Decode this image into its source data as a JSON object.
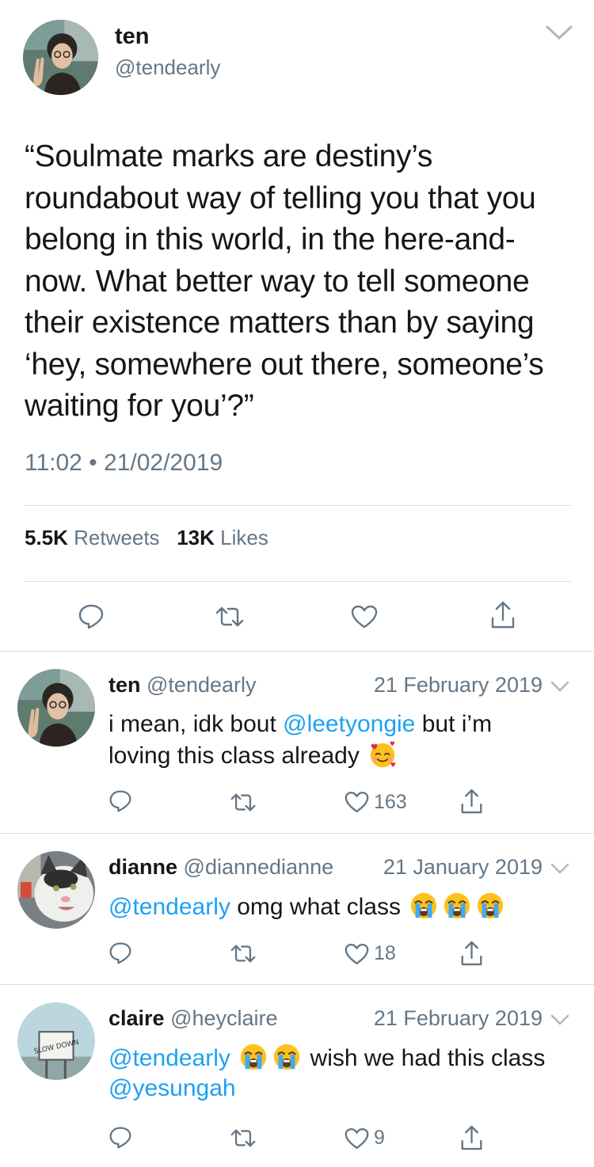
{
  "main": {
    "name": "ten",
    "handle": "@tendearly",
    "text": "“Soulmate marks are destiny’s roundabout way of telling you that you belong in this world, in the here-and-now. What better way to tell someone their existence matters than by saying ‘hey, somewhere out there, someone’s waiting for you’?”",
    "timestamp": "11:02 • 21/02/2019",
    "retweets_count": "5.5K",
    "retweets_label": "Retweets",
    "likes_count": "13K",
    "likes_label": "Likes"
  },
  "replies": [
    {
      "name": "ten",
      "handle": "@tendearly",
      "date": "21 February 2019",
      "text_pre": "i mean, idk bout ",
      "mention": "@leetyongie",
      "text_post": " but i’m loving this class already",
      "emoji": "smiling-face-with-hearts",
      "like_count": "163"
    },
    {
      "name": "dianne",
      "handle": "@diannedianne",
      "date": "21 January 2019",
      "mention": "@tendearly",
      "text_post": " omg what class",
      "emoji": "loudly-crying-face",
      "like_count": "18"
    },
    {
      "name": "claire",
      "handle": "@heyclaire",
      "date": "21 February 2019",
      "mention": "@tendearly",
      "text_mid": " wish we had this class ",
      "mention2": "@yesungah",
      "emoji": "loudly-crying-face",
      "like_count": "9"
    }
  ],
  "colors": {
    "text": "#14171a",
    "secondary": "#657786",
    "link": "#1da1f2",
    "divider": "#d7dde2"
  }
}
